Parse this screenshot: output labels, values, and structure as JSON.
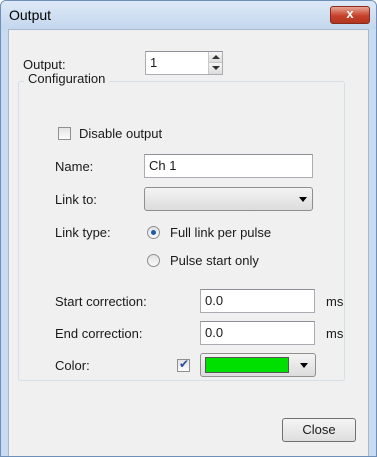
{
  "window": {
    "title": "Output",
    "close_glyph": "x"
  },
  "output": {
    "label": "Output:",
    "value": "1"
  },
  "configuration": {
    "group_title": "Configuration",
    "disable_output": {
      "label": "Disable output",
      "checked": false
    },
    "name": {
      "label": "Name:",
      "value": "Ch 1"
    },
    "link_to": {
      "label": "Link to:",
      "value": ""
    },
    "link_type": {
      "label": "Link type:",
      "options": [
        {
          "label": "Full link per pulse",
          "selected": true
        },
        {
          "label": "Pulse start only",
          "selected": false
        }
      ]
    },
    "start_correction": {
      "label": "Start correction:",
      "value": "0.0",
      "unit": "ms"
    },
    "end_correction": {
      "label": "End correction:",
      "value": "0.0",
      "unit": "ms"
    },
    "color": {
      "label": "Color:",
      "enabled": true,
      "swatch": "#00e000"
    }
  },
  "buttons": {
    "close": "Close"
  },
  "icons": {
    "window_close": "close-icon",
    "spin_up": "spin-up-icon",
    "spin_down": "spin-down-icon",
    "dropdown": "chevron-down-icon"
  }
}
